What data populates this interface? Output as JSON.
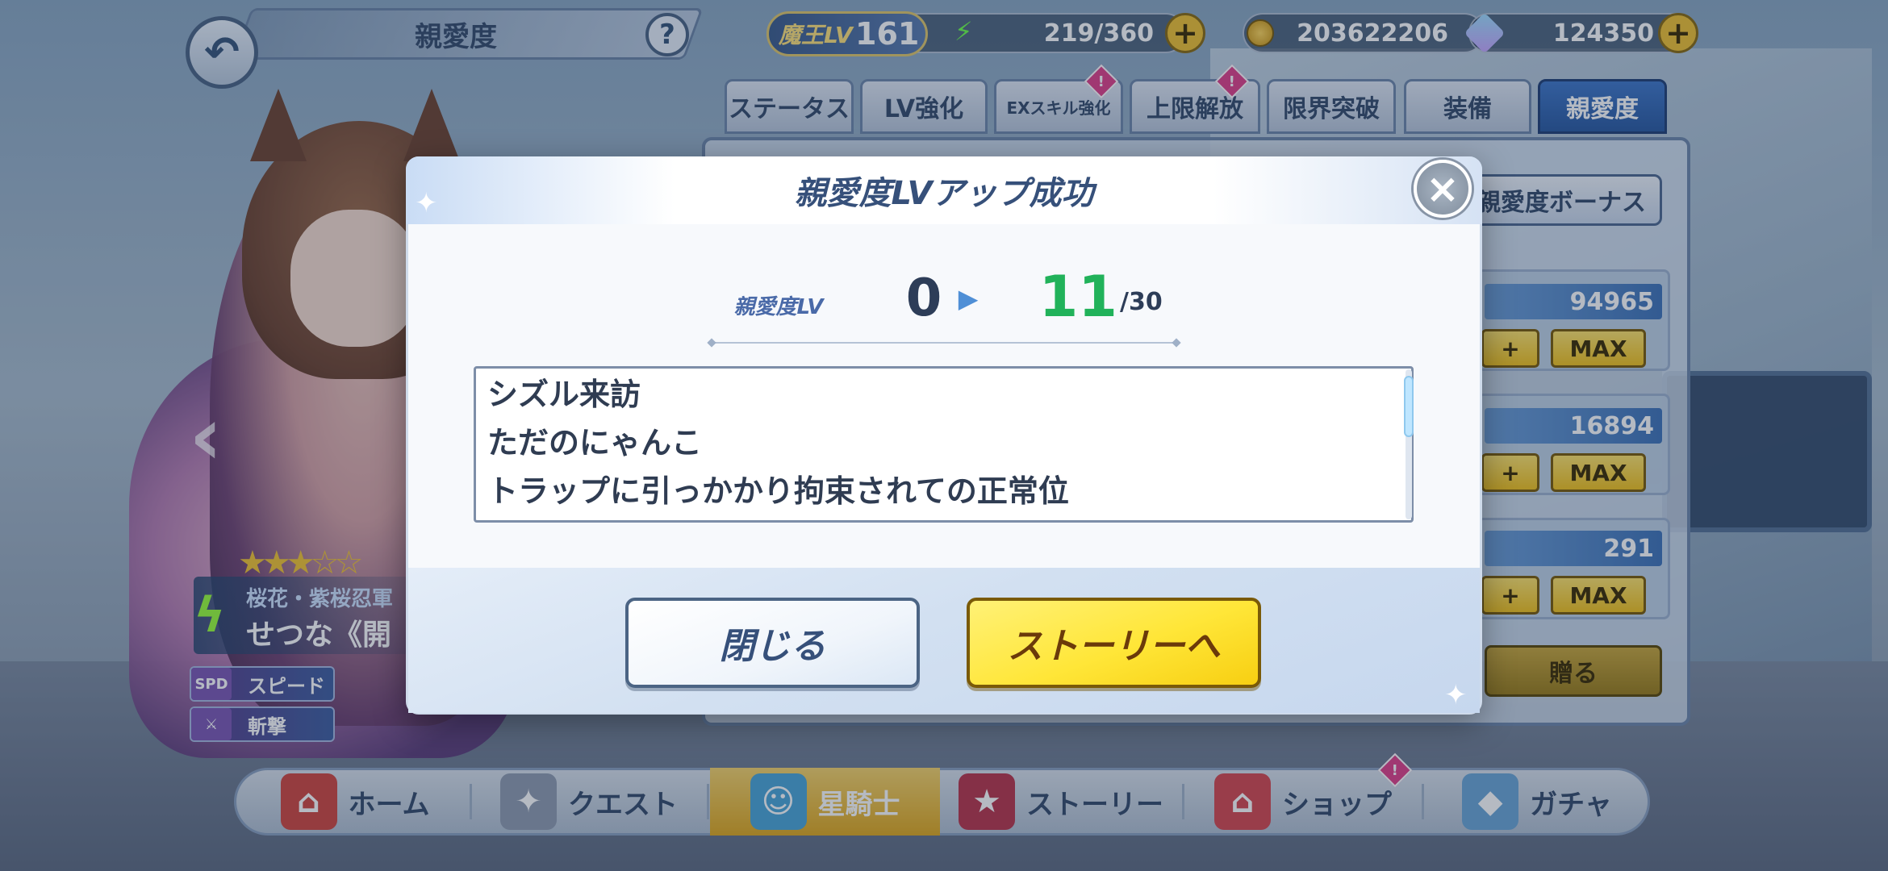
{
  "header": {
    "title": "親愛度",
    "back_icon": "back-arrow-icon",
    "help_label": "?"
  },
  "resources": {
    "player_level_label": "魔王LV",
    "player_level": "161",
    "stamina": "219/360",
    "gold": "203622206",
    "gems": "124350",
    "plus_label": "+"
  },
  "tabs": [
    {
      "label": "ステータス",
      "active": false,
      "notice": false
    },
    {
      "label": "LV強化",
      "active": false,
      "notice": false
    },
    {
      "label": "EXスキル強化",
      "active": false,
      "notice": true
    },
    {
      "label": "上限解放",
      "active": false,
      "notice": true
    },
    {
      "label": "限界突破",
      "active": false,
      "notice": false
    },
    {
      "label": "装備",
      "active": false,
      "notice": false
    },
    {
      "label": "親愛度",
      "active": true,
      "notice": false
    }
  ],
  "notice_mark": "!",
  "side_panel": {
    "bonus_button": "親愛度ボーナス",
    "items": [
      {
        "count": "94965",
        "plus": "+",
        "max": "MAX"
      },
      {
        "count": "16894",
        "plus": "+",
        "max": "MAX"
      },
      {
        "count": "291",
        "plus": "+",
        "max": "MAX"
      }
    ],
    "send_button": "贈る"
  },
  "character": {
    "rarity_stars": "★★★☆☆",
    "subtitle": "桜花・紫桜忍軍",
    "name": "せつな《開",
    "traits": [
      {
        "icon": "SPD",
        "label": "スピード"
      },
      {
        "icon": "⚔",
        "label": "斬撃"
      }
    ],
    "prev_arrow": "‹"
  },
  "bottom_nav": [
    {
      "label": "ホーム",
      "icon": "home-icon",
      "active": false
    },
    {
      "label": "クエスト",
      "icon": "quest-icon",
      "active": false
    },
    {
      "label": "星騎士",
      "icon": "star-knight-icon",
      "active": true
    },
    {
      "label": "ストーリー",
      "icon": "story-book-icon",
      "active": false
    },
    {
      "label": "ショップ",
      "icon": "shop-icon",
      "active": false,
      "notice": true
    },
    {
      "label": "ガチャ",
      "icon": "gacha-icon",
      "active": false
    }
  ],
  "modal": {
    "title": "親愛度LVアップ成功",
    "close_icon": "×",
    "level_caption": "親愛度LV",
    "level_from": "0",
    "level_to": "11",
    "level_max": "/30",
    "stories": [
      "シズル来訪",
      "ただのにゃんこ",
      "トラップに引っかかり拘束されての正常位"
    ],
    "close_button": "閉じる",
    "story_button": "ストーリーへ"
  },
  "colors": {
    "accent_blue": "#2a59a0",
    "level_green": "#21b25a",
    "button_yellow": "#ffe638",
    "title_navy": "#36507a"
  }
}
